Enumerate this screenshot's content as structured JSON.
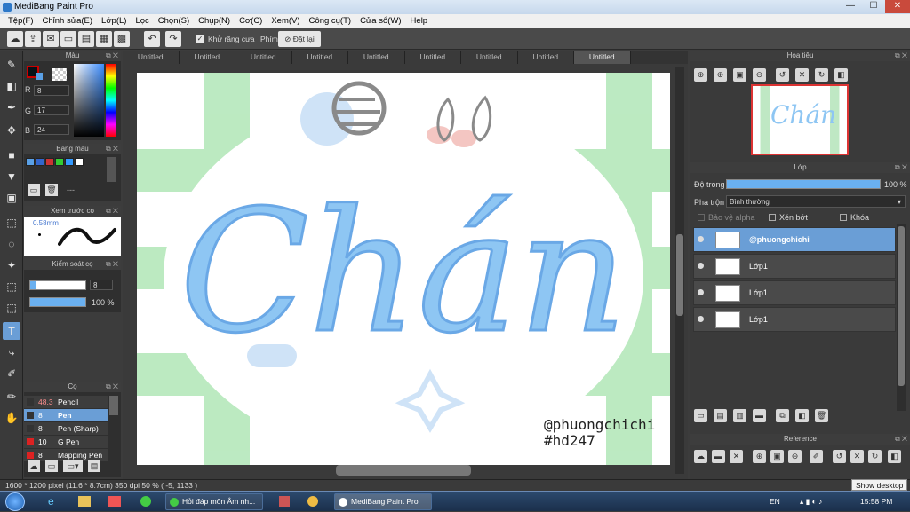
{
  "window": {
    "title": "MediBang Paint Pro",
    "min": "—",
    "max": "☐",
    "close": "✕"
  },
  "menu": [
    "Tệp(F)",
    "Chỉnh sửa(E)",
    "Lớp(L)",
    "Lọc",
    "Chọn(S)",
    "Chụp(N)",
    "Cơ(C)",
    "Xem(V)",
    "Công cụ(T)",
    "Cửa sổ(W)",
    "Help"
  ],
  "toolbar": {
    "antialias": "Khử răng cưa",
    "key_label": "Phím",
    "reset": "Đặt lại"
  },
  "color_panel": {
    "title": "Màu",
    "r_label": "R",
    "r": "8",
    "g_label": "G",
    "g": "17",
    "b_label": "B",
    "b": "24",
    "fg": "#081118",
    "accent": "#cc0000"
  },
  "palette_panel": {
    "title": "Bảng màu",
    "swatches": [
      "#5aa0e6",
      "#3366cc",
      "#cc3333",
      "#33cc33",
      "#3399ff",
      "#ffffff"
    ],
    "dash": "---"
  },
  "preview_panel": {
    "title": "Xem trước cọ",
    "size": "0.58mm"
  },
  "brush_control": {
    "title": "Kiểm soát cọ",
    "size": "8",
    "opacity": "100 %"
  },
  "brush_panel": {
    "title": "Cọ",
    "items": [
      {
        "size": "48.3",
        "name": "Pencil",
        "color": "#333333"
      },
      {
        "size": "8",
        "name": "Pen",
        "color": "#333333"
      },
      {
        "size": "8",
        "name": "Pen (Sharp)",
        "color": "#333333"
      },
      {
        "size": "10",
        "name": "G Pen",
        "color": "#dd2222"
      },
      {
        "size": "8",
        "name": "Mapping Pen",
        "color": "#dd2222"
      }
    ]
  },
  "tabs": [
    "Untitled",
    "Untitled",
    "Untitled",
    "Untitled",
    "Untitled",
    "Untitled",
    "Untitled",
    "Untitled",
    "Untitled"
  ],
  "canvas": {
    "lettering": "Chán",
    "watermark1": "@phuongchichi",
    "watermark2": "#hd247"
  },
  "navigator": {
    "title": "Hoa tiêu",
    "thumb_text": "Chán"
  },
  "layer_panel": {
    "title": "Lớp",
    "opacity_label": "Độ trong",
    "opacity": "100 %",
    "blend_label": "Pha trộn",
    "blend": "Bình thường",
    "protect_alpha": "Bảo vệ alpha",
    "clipping": "Xén bớt",
    "lock": "Khóa",
    "layers": [
      "@phuongchichi",
      "Lớp1",
      "Lớp1",
      "Lớp1"
    ]
  },
  "reference_panel": {
    "title": "Reference"
  },
  "status": {
    "info": "1600 * 1200 pixel   (11.6 * 8.7cm)   350 dpi   50 %   ( -5, 1133 )"
  },
  "taskbar": {
    "task1": "Hỏi đáp môn Âm nh...",
    "task2": "MediBang Paint Pro",
    "lang": "EN",
    "time": "15:58 PM",
    "show_desktop": "Show desktop"
  }
}
